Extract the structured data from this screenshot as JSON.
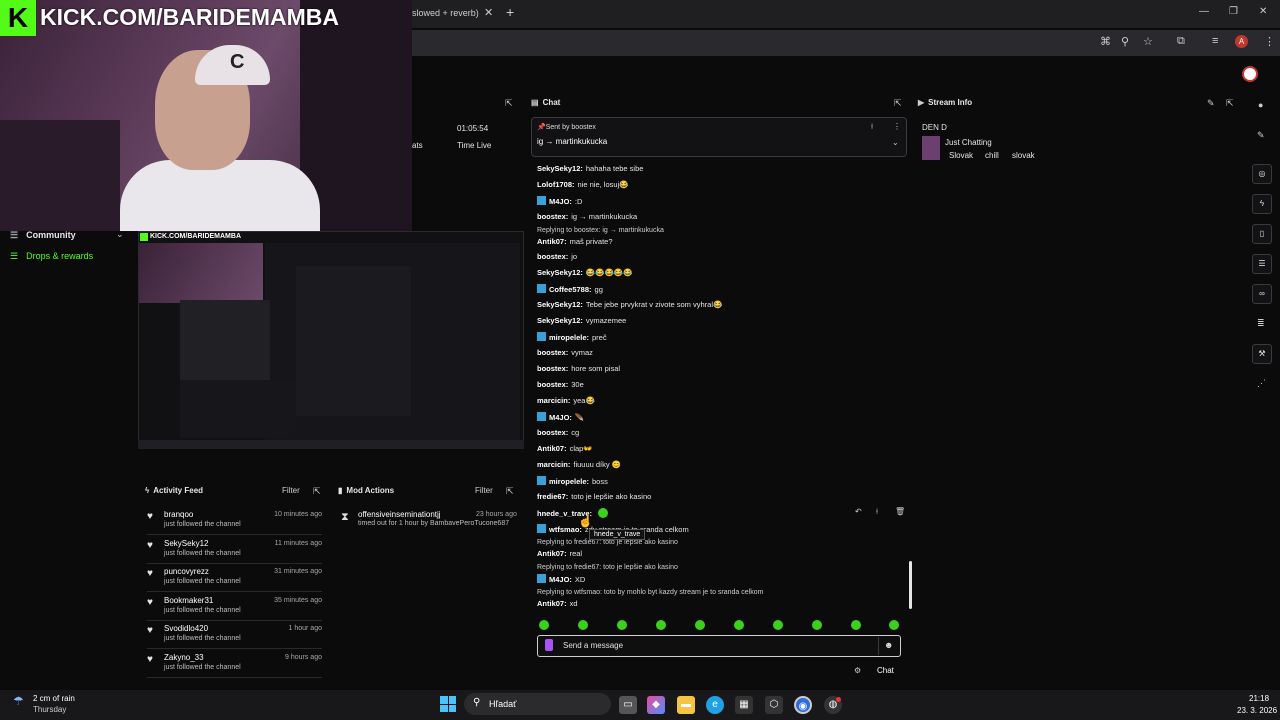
{
  "browser": {
    "tab_title": "slowed + reverb)",
    "tab_close": "✕",
    "new_tab": "+",
    "win_controls": [
      "—",
      "❐",
      "✕"
    ],
    "profile_initial": "A"
  },
  "overlay": {
    "kick_logo": "K",
    "kick_title": "KICK.COM/BARIDEMAMBA",
    "cap_letter": "C"
  },
  "left_nav": {
    "community": "Community",
    "drops": "Drops & rewards"
  },
  "preview": {
    "title": "KICK.COM/BARIDEMAMBA"
  },
  "metrics": {
    "time_value": "01:05:54",
    "time_label": "Time Live",
    "cut_label": "ats"
  },
  "chat": {
    "title": "Chat",
    "pinned_by": "Sent by boostex",
    "pinned_msg": "ig → martinkukucka",
    "messages": [
      {
        "user": "SekySeky12:",
        "text": "hahaha tebe sibe",
        "badge": false
      },
      {
        "user": "Lolof1708:",
        "text": "nie nie, losuj😂",
        "badge": false
      },
      {
        "user": "M4JO:",
        "text": ":D",
        "badge": true
      },
      {
        "user": "boostex:",
        "text": "ig → martinkukucka",
        "badge": false
      },
      {
        "reply": "Replying to boostex: ig → martinkukucka",
        "user": "Antik07:",
        "text": "maš private?",
        "badge": false
      },
      {
        "user": "boostex:",
        "text": "jo",
        "badge": false
      },
      {
        "user": "SekySeky12:",
        "text": "😂😂😂😂😂",
        "badge": false
      },
      {
        "user": "Coffee5788:",
        "text": "gg",
        "badge": true
      },
      {
        "user": "SekySeky12:",
        "text": "Tebe jebe prvykrat v zivote som vyhral😂",
        "badge": false
      },
      {
        "user": "SekySeky12:",
        "text": "vymazemee",
        "badge": false
      },
      {
        "user": "miropelele:",
        "text": "preč",
        "badge": true
      },
      {
        "user": "boostex:",
        "text": "vymaz",
        "badge": false
      },
      {
        "user": "boostex:",
        "text": "hore som pisal",
        "badge": false
      },
      {
        "user": "boostex:",
        "text": "30e",
        "badge": false
      },
      {
        "user": "marcicin:",
        "text": "yea😂",
        "badge": false
      },
      {
        "user": "M4JO:",
        "text": "🪶",
        "badge": true
      },
      {
        "user": "boostex:",
        "text": "cg",
        "badge": false
      },
      {
        "user": "Antik07:",
        "text": "clap👐",
        "badge": false
      },
      {
        "user": "marcicin:",
        "text": "fiuuuu díky 😊",
        "badge": false
      },
      {
        "user": "miropelele:",
        "text": "boss",
        "badge": true
      },
      {
        "user": "fredie67:",
        "text": "toto je lepšie ako kasino",
        "badge": false
      },
      {
        "user": "hnede_v_trave:",
        "text": "",
        "badge": false
      },
      {
        "user": "wtfsmao:",
        "text": "zdy stream je to sranda celkom",
        "badge": true
      },
      {
        "reply": "Replying to fredie67: toto je lepšie ako kasino",
        "user": "Antik07:",
        "text": "real",
        "badge": false
      },
      {
        "reply": "Replying to fredie67: toto je lepšie ako kasino",
        "user": "M4JO:",
        "text": "XD",
        "badge": true
      },
      {
        "reply": "Replying to wtfsmao: toto by mohlo byt kazdy stream je to sranda celkom",
        "user": "Antik07:",
        "text": "xd",
        "badge": false
      }
    ],
    "tooltip": "hnede_v_trave",
    "input_placeholder": "Send a message",
    "send_label": "Chat"
  },
  "stream_info": {
    "title": "Stream Info",
    "stream_title": "DEN D",
    "category": "Just Chatting",
    "tags": [
      "Slovak",
      "chill",
      "slovak"
    ]
  },
  "activity_feed": {
    "title": "Activity Feed",
    "filter": "Filter",
    "items": [
      {
        "name": "branqoo",
        "action": "just followed the channel",
        "time": "10 minutes ago"
      },
      {
        "name": "SekySeky12",
        "action": "just followed the channel",
        "time": "11 minutes ago"
      },
      {
        "name": "puncovyrezz",
        "action": "just followed the channel",
        "time": "31 minutes ago"
      },
      {
        "name": "Bookmaker31",
        "action": "just followed the channel",
        "time": "35 minutes ago"
      },
      {
        "name": "Svodidlo420",
        "action": "just followed the channel",
        "time": "1 hour ago"
      },
      {
        "name": "Zakyno_33",
        "action": "just followed the channel",
        "time": "9 hours ago"
      }
    ]
  },
  "mod_actions": {
    "title": "Mod Actions",
    "filter": "Filter",
    "items": [
      {
        "name": "offensiveinseminationtjj",
        "action": "timed out for 1 hour by BambavePeroTucone687",
        "time": "23 hours ago"
      }
    ]
  },
  "taskbar": {
    "weather": "2 cm of rain",
    "day": "Thursday",
    "search": "Hľadať",
    "time": "21:18",
    "date": "23. 3. 2026"
  },
  "colors": {
    "kick_green": "#53fc18",
    "badge_blue": "#3aa0d8",
    "emote_green": "#3bd11a"
  }
}
